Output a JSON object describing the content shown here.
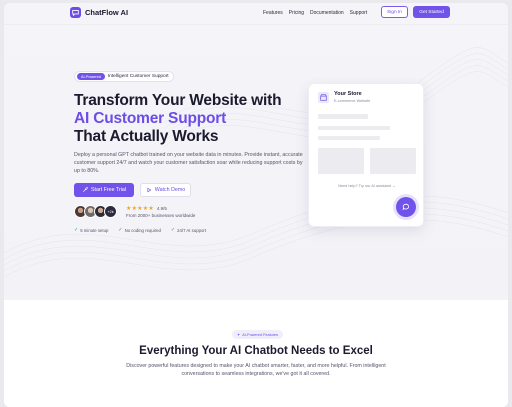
{
  "nav": {
    "logo_text": "ChatFlow AI",
    "logo_icon": "chat-bubble-icon",
    "links": [
      "Features",
      "Pricing",
      "Documentation",
      "Support"
    ],
    "sign_in": "Sign In",
    "get_started": "Get Started"
  },
  "hero": {
    "pill_tag": "AI-Powered",
    "pill_text": "Intelligent Customer Support",
    "title_line1": "Transform Your Website with",
    "title_accent": "AI Customer Support",
    "title_line3": "That Actually Works",
    "description": "Deploy a personal GPT chatbot trained on your website data in minutes. Provide instant, accurate customer support 24/7 and watch your customer satisfaction soar while reducing support costs by up to 80%.",
    "cta_primary": "Start Free Trial",
    "cta_secondary": "Watch Demo",
    "avatar_count": "+2k",
    "stars": "★★★★★",
    "rating_value": "4.9/5",
    "rating_sub": "From 2000+ businesses worldwide",
    "features": [
      "5 minute setup",
      "No coding required",
      "24/7 AI support"
    ]
  },
  "preview_card": {
    "title": "Your Store",
    "subtitle": "E-commerce Website",
    "help_text": "Need help? Try our AI assistant →"
  },
  "section2": {
    "badge": "AI-Powered Features",
    "title": "Everything Your AI Chatbot Needs to Excel",
    "description": "Discover powerful features designed to make your AI chatbot smarter, faster, and more helpful. From intelligent conversations to seamless integrations, we've got it all covered."
  },
  "colors": {
    "accent": "#7152ea",
    "star": "#f5a524",
    "check": "#22a06b"
  }
}
